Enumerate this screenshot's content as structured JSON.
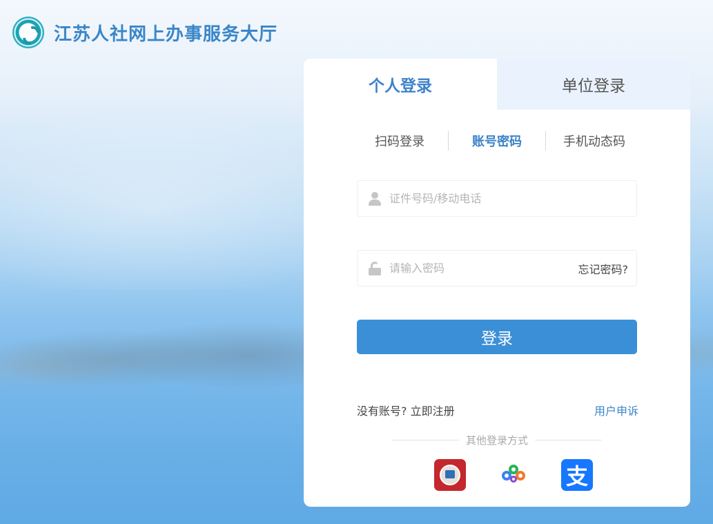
{
  "header": {
    "site_title": "江苏人社网上办事服务大厅",
    "logo_icon": "jiangsu-hrss-logo-icon"
  },
  "tabs": [
    {
      "label": "个人登录",
      "active": true
    },
    {
      "label": "单位登录",
      "active": false
    }
  ],
  "subtabs": [
    {
      "label": "扫码登录",
      "active": false
    },
    {
      "label": "账号密码",
      "active": true
    },
    {
      "label": "手机动态码",
      "active": false
    }
  ],
  "form": {
    "username": {
      "value": "",
      "placeholder": "证件号码/移动电话",
      "icon": "user-icon"
    },
    "password": {
      "value": "",
      "placeholder": "请输入密码",
      "icon": "lock-icon"
    },
    "forgot_label": "忘记密码?",
    "login_label": "登录"
  },
  "footer": {
    "no_account": "没有账号?",
    "register_label": "立即注册",
    "appeal_label": "用户申诉",
    "other_methods": "其他登录方式"
  },
  "other_logins": [
    {
      "name": "jiangsu-renshe-app",
      "icon": "jsrs-app-icon",
      "color": "#c4272d"
    },
    {
      "name": "cloud-app",
      "icon": "cloud-app-icon",
      "color": "#ffffff"
    },
    {
      "name": "alipay",
      "icon": "alipay-icon",
      "glyph": "支",
      "color": "#1677ff"
    }
  ],
  "colors": {
    "accent": "#3d83c8",
    "button": "#3b8fd6",
    "inactive_tab_bg": "#eaf3fd"
  }
}
